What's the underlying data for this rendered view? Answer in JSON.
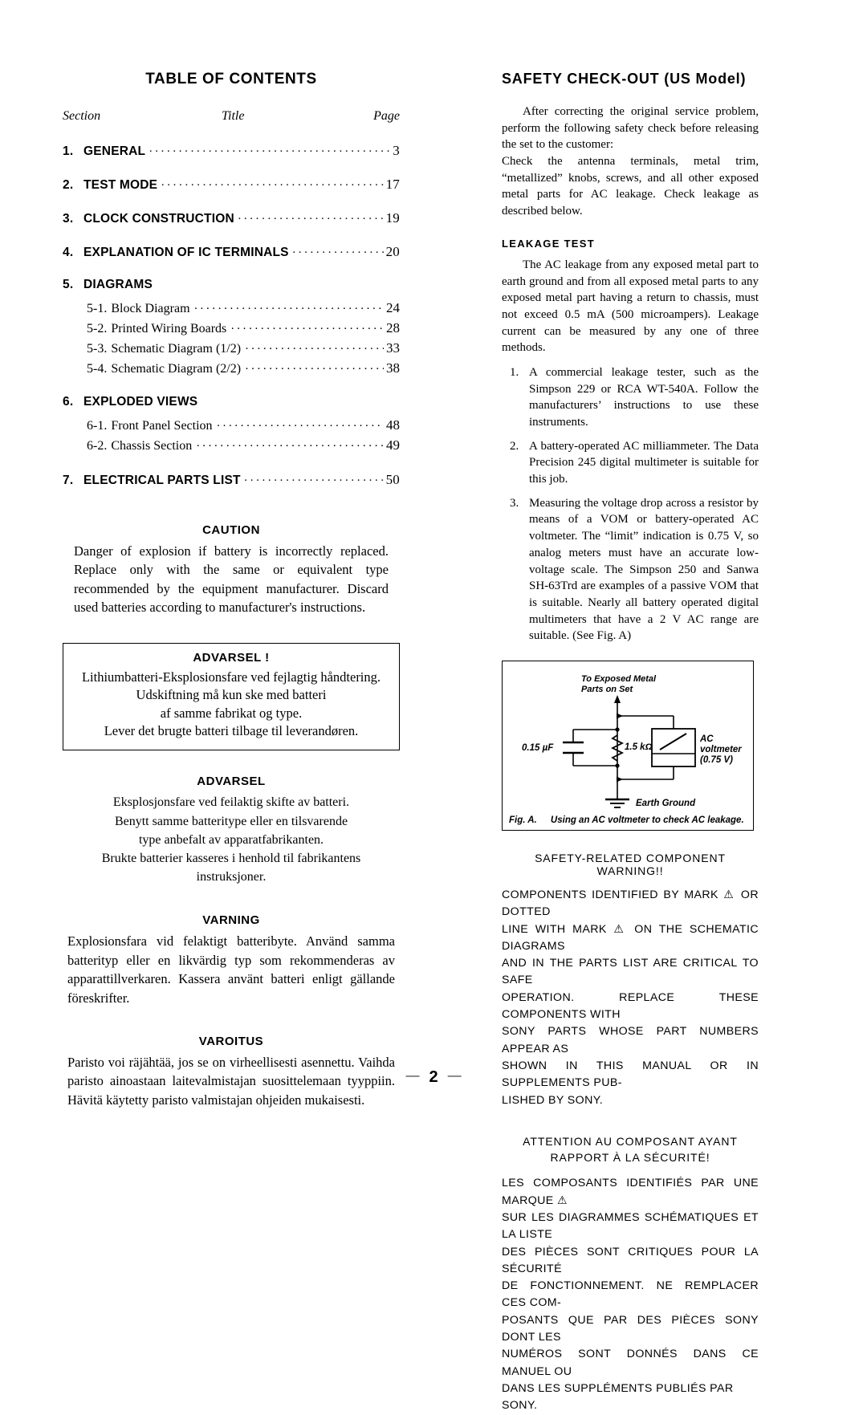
{
  "page_number": "2",
  "footer_dash_left": "—",
  "footer_dash_right": "—",
  "toc": {
    "title": "TABLE OF CONTENTS",
    "headers": {
      "section": "Section",
      "title": "Title",
      "page": "Page"
    },
    "entries": [
      {
        "num": "1.",
        "label": "GENERAL",
        "page": "3",
        "leader": true
      },
      {
        "num": "2.",
        "label": "TEST MODE",
        "page": "17",
        "leader": true
      },
      {
        "num": "3.",
        "label": "CLOCK CONSTRUCTION",
        "page": "19",
        "leader": true
      },
      {
        "num": "4.",
        "label": "EXPLANATION OF IC TERMINALS",
        "page": "20",
        "leader": true
      },
      {
        "num": "5.",
        "label": "DIAGRAMS",
        "page": "",
        "leader": false
      },
      {
        "num": "6.",
        "label": "EXPLODED VIEWS",
        "page": "",
        "leader": false
      },
      {
        "num": "7.",
        "label": "ELECTRICAL PARTS LIST",
        "page": "50",
        "leader": true
      }
    ],
    "diagrams_subs": [
      {
        "num": "5-1.",
        "label": "Block Diagram",
        "page": "24"
      },
      {
        "num": "5-2.",
        "label": "Printed Wiring Boards",
        "page": "28"
      },
      {
        "num": "5-3.",
        "label": "Schematic Diagram (1/2)",
        "page": "33"
      },
      {
        "num": "5-4.",
        "label": "Schematic Diagram (2/2)",
        "page": "38"
      }
    ],
    "exploded_subs": [
      {
        "num": "6-1.",
        "label": "Front Panel Section",
        "page": "48"
      },
      {
        "num": "6-2.",
        "label": "Chassis Section",
        "page": "49"
      }
    ],
    "dots": "····························································································································"
  },
  "caution": {
    "heading": "CAUTION",
    "body": "Danger of explosion if battery is incorrectly replaced. Replace only with the same or equivalent type recommended by the equipment manufacturer. Discard used batteries according to manufacturer's instructions."
  },
  "advarsel_box": {
    "heading": "ADVARSEL !",
    "lines": [
      "Lithiumbatteri-Eksplosionsfare ved fejlagtig håndtering.",
      "Udskiftning må kun ske med batteri",
      "af samme fabrikat og type.",
      "Lever det brugte batteri tilbage til leverandøren."
    ]
  },
  "advarsel_no": {
    "heading": "ADVARSEL",
    "lines": [
      "Eksplosjonsfare ved feilaktig skifte av batteri.",
      "Benytt samme batteritype eller en tilsvarende",
      "type anbefalt av apparatfabrikanten.",
      "Brukte batterier kasseres i henhold til fabrikantens",
      "instruksjoner."
    ]
  },
  "varning": {
    "heading": "VARNING",
    "body": "Explosionsfara vid felaktigt batteribyte. Använd samma batterityp eller en likvärdig typ som rekommenderas av apparattillverkaren. Kassera använt batteri enligt gällande föreskrifter."
  },
  "varoitus": {
    "heading": "VAROITUS",
    "body": "Paristo voi räjähtää, jos se on virheellisesti asennettu. Vaihda paristo ainoastaan laitevalmistajan suosittelemaan tyyppiin. Hävitä käytetty paristo valmistajan ohjeiden mukaisesti."
  },
  "safety": {
    "heading": "SAFETY CHECK-OUT  (US Model)",
    "intro1": "After correcting the original service problem, perform the following safety check before releasing the set to the customer:",
    "intro2": "Check the antenna terminals, metal trim, “metallized” knobs, screws, and all other exposed metal parts for AC leakage.  Check leakage as described below.",
    "leakage_heading": "LEAKAGE TEST",
    "leakage_intro": "The AC leakage from any exposed metal part to earth ground and from all exposed metal parts to any exposed metal part having a return to chassis, must not exceed 0.5 mA (500 microampers).   Leakage current can be measured by any one of three methods.",
    "methods": [
      {
        "n": "1.",
        "text": "A commercial leakage tester, such as the Simpson 229 or RCA WT-540A.  Follow the manufacturers’ instructions to use these instruments."
      },
      {
        "n": "2.",
        "text": "A battery-operated AC milliammeter. The Data Precision 245 digital multimeter is suitable for this job."
      },
      {
        "n": "3.",
        "text": "Measuring the voltage drop across a resistor by means of a VOM or battery-operated AC voltmeter.   The “limit” indication is 0.75 V, so analog meters must have an accurate low-voltage scale.  The Simpson 250 and Sanwa SH-63Trd are examples of a passive VOM that is suitable.  Nearly all battery operated digital multimeters that have a 2 V AC range are suitable.  (See Fig. A)"
      }
    ]
  },
  "figure": {
    "label_top_line1": "To Exposed Metal",
    "label_top_line2": "Parts on Set",
    "label_cap": "0.15 µF",
    "label_res": "1.5 kΩ",
    "label_meter_line1": "AC",
    "label_meter_line2": "voltmeter",
    "label_meter_line3": "(0.75 V)",
    "label_ground": "Earth Ground",
    "caption_num": "Fig. A.",
    "caption_text": "Using an AC voltmeter to check AC leakage."
  },
  "component_warning": {
    "heading": "SAFETY-RELATED COMPONENT WARNING!!",
    "lines": [
      "COMPONENTS IDENTIFIED BY MARK ⚠ OR DOTTED",
      "LINE WITH MARK ⚠ ON THE SCHEMATIC DIAGRAMS",
      "AND IN THE PARTS LIST ARE CRITICAL TO SAFE",
      "OPERATION.  REPLACE THESE COMPONENTS WITH",
      "SONY PARTS WHOSE PART NUMBERS APPEAR AS",
      "SHOWN IN THIS MANUAL OR IN SUPPLEMENTS PUB-",
      "LISHED BY SONY."
    ]
  },
  "component_warning_fr": {
    "heading_line1": "ATTENTION AU COMPOSANT AYANT RAPPORT",
    "heading_line2": "À LA SÉCURITÉ!",
    "lines": [
      "LES COMPOSANTS IDENTIFIÉS PAR UNE MARQUE ⚠",
      "SUR LES DIAGRAMMES SCHÉMATIQUES ET LA LISTE",
      "DES PIÈCES SONT CRITIQUES POUR LA SÉCURITÉ",
      "DE FONCTIONNEMENT.  NE REMPLACER CES COM-",
      "POSANTS QUE PAR DES PIÈCES SONY DONT LES",
      "NUMÉROS SONT DONNÉS DANS CE MANUEL OU",
      "DANS LES SUPPLÉMENTS PUBLIÉS PAR SONY."
    ]
  }
}
